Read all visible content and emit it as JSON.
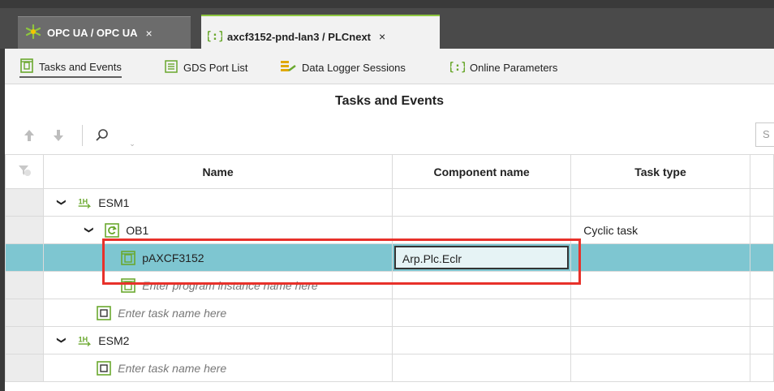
{
  "window_tabs": [
    {
      "label": "OPC UA / OPC UA",
      "icon": "opcua-star-icon",
      "close": "×"
    },
    {
      "label": "axcf3152-pnd-lan3 / PLCnext",
      "icon": "plcnext-brace-icon",
      "close": "×"
    }
  ],
  "sub_tabs": [
    {
      "label": "Tasks and Events",
      "icon": "tasks-icon"
    },
    {
      "label": "GDS Port List",
      "icon": "list-icon"
    },
    {
      "label": "Data Logger Sessions",
      "icon": "datalogger-icon"
    },
    {
      "label": "Online Parameters",
      "icon": "online-params-icon"
    }
  ],
  "panel": {
    "title": "Tasks and Events",
    "search_placeholder": "S"
  },
  "columns": [
    "Name",
    "Component name",
    "Task type"
  ],
  "rows": [
    {
      "name": "ESM1",
      "component": "",
      "task_type": ""
    },
    {
      "name": "OB1",
      "component": "",
      "task_type": "Cyclic task"
    },
    {
      "name": "pAXCF3152",
      "component": "Arp.Plc.Eclr",
      "task_type": ""
    },
    {
      "name": "Enter program instance name here",
      "component": "",
      "task_type": ""
    },
    {
      "name": "Enter task name here",
      "component": "",
      "task_type": ""
    },
    {
      "name": "ESM2",
      "component": "",
      "task_type": ""
    },
    {
      "name": "Enter task name here",
      "component": "",
      "task_type": ""
    }
  ],
  "colors": {
    "accent_green": "#8dc63f",
    "selection": "#7ec6d1",
    "highlight_red": "#e8312a"
  }
}
